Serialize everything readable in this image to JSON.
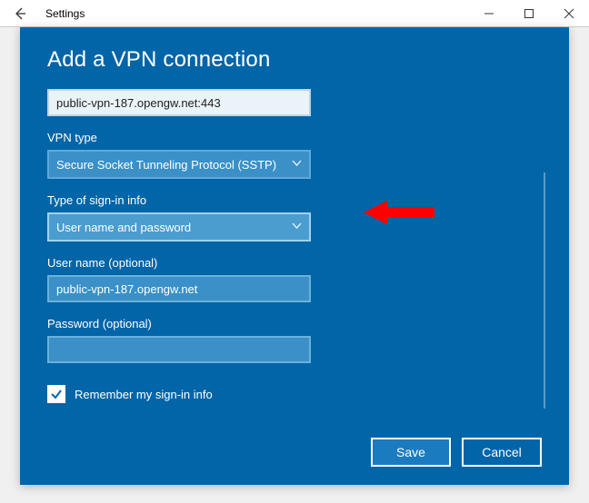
{
  "titlebar": {
    "app_title": "Settings"
  },
  "panel": {
    "heading": "Add a VPN connection",
    "server_value": "public-vpn-187.opengw.net:443",
    "vpn_type_label": "VPN type",
    "vpn_type_value": "Secure Socket Tunneling Protocol (SSTP)",
    "signin_label": "Type of sign-in info",
    "signin_value": "User name and password",
    "username_label": "User name (optional)",
    "username_value": "public-vpn-187.opengw.net",
    "password_label": "Password (optional)",
    "password_value": "",
    "remember_label": "Remember my sign-in info",
    "remember_checked": true,
    "save_label": "Save",
    "cancel_label": "Cancel"
  }
}
